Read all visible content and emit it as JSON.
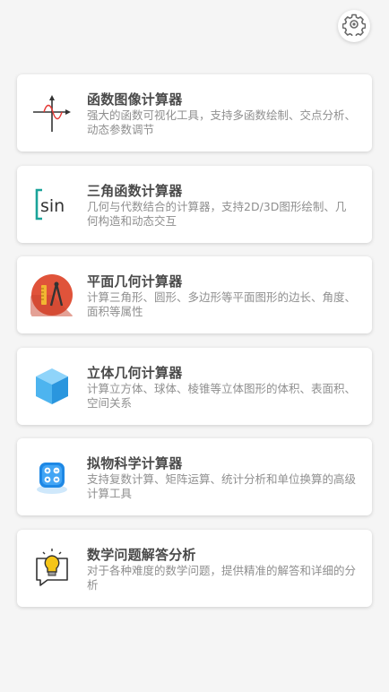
{
  "header": {
    "settings_icon": "gear-icon"
  },
  "cards": [
    {
      "icon": "function-graph-icon",
      "title": "函数图像计算器",
      "desc": "强大的函数可视化工具，支持多函数绘制、交点分析、动态参数调节"
    },
    {
      "icon": "sin-icon",
      "icon_text": "sin",
      "title": "三角函数计算器",
      "desc": "几何与代数结合的计算器，支持2D/3D图形绘制、几何构造和动态交互"
    },
    {
      "icon": "compass-ruler-icon",
      "title": "平面几何计算器",
      "desc": "计算三角形、圆形、多边形等平面图形的边长、角度、面积等属性"
    },
    {
      "icon": "cube-icon",
      "title": "立体几何计算器",
      "desc": "计算立方体、球体、棱锥等立体图形的体积、表面积、空间关系"
    },
    {
      "icon": "calculator-icon",
      "title": "拟物科学计算器",
      "desc": "支持复数计算、矩阵运算、统计分析和单位换算的高级计算工具"
    },
    {
      "icon": "lightbulb-icon",
      "title": "数学问题解答分析",
      "desc": "对于各种难度的数学问题，提供精准的解答和详细的分析"
    }
  ],
  "colors": {
    "background": "#f5f5f5",
    "card": "#ffffff",
    "title": "#4a4a4a",
    "desc": "#8f8f8f",
    "accent_teal": "#1aa39a",
    "geometry_red": "#e0533a",
    "cube_blue": "#4db4ef",
    "calc_blue": "#1e88e5",
    "bulb_yellow": "#f5c518"
  }
}
